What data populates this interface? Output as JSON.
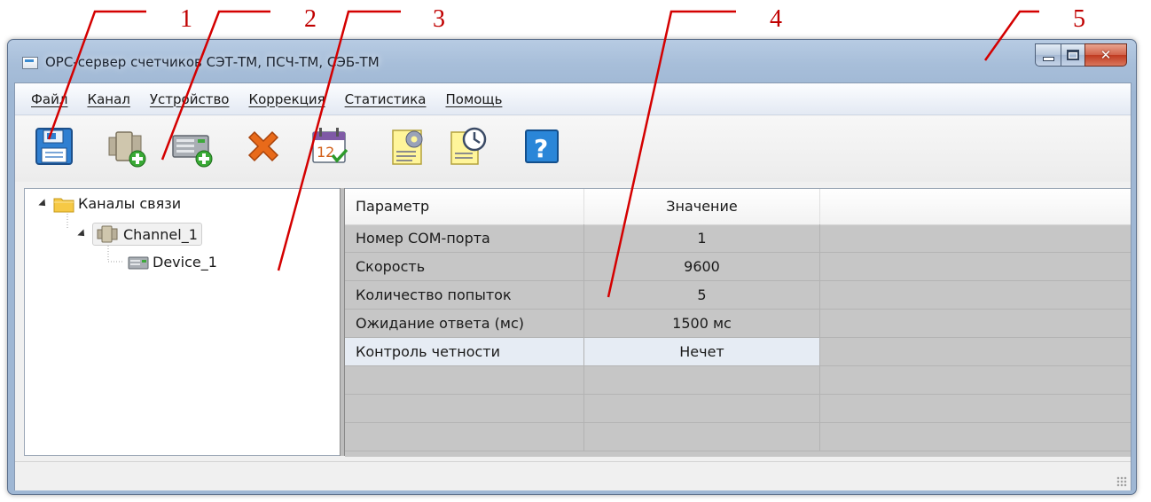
{
  "window": {
    "title": "OPC-сервер счетчиков СЭТ-ТМ, ПСЧ-ТМ, СЭБ-ТМ"
  },
  "callouts": [
    "1",
    "2",
    "3",
    "4",
    "5"
  ],
  "menu": [
    "Файл",
    "Канал",
    "Устройство",
    "Коррекция",
    "Статистика",
    "Помощь"
  ],
  "toolbar": [
    {
      "icon": "save-icon"
    },
    {
      "icon": "add-channel-icon"
    },
    {
      "icon": "add-device-icon"
    },
    {
      "icon": "delete-icon"
    },
    {
      "icon": "calendar-icon"
    },
    {
      "icon": "settings-document-icon"
    },
    {
      "icon": "clock-document-icon"
    },
    {
      "icon": "help-icon"
    }
  ],
  "tree": {
    "root": "Каналы связи",
    "channel": "Channel_1",
    "device": "Device_1"
  },
  "grid": {
    "headers": [
      "Параметр",
      "Значение"
    ],
    "rows": [
      {
        "param": "Номер COM-порта",
        "value": "1"
      },
      {
        "param": "Скорость",
        "value": "9600"
      },
      {
        "param": "Количество попыток",
        "value": "5"
      },
      {
        "param": "Ожидание ответа (мс)",
        "value": "1500 мс"
      },
      {
        "param": "Контроль четности",
        "value": "Нечет"
      }
    ]
  },
  "colors": {
    "callout": "#c00000",
    "titlebar": "#a7bed9",
    "grid_bg": "#c6c6c6"
  }
}
